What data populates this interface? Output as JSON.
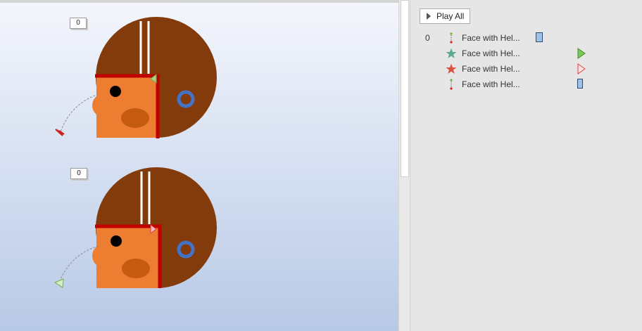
{
  "slide": {
    "tags": [
      "0",
      "0"
    ]
  },
  "pane": {
    "play_all_label": "Play All",
    "items": [
      {
        "number": "0",
        "label": "Face with Hel...",
        "icon": "motion-path-icon",
        "timeline": "timeline-bar-blue"
      },
      {
        "number": "",
        "label": "Face with Hel...",
        "icon": "entrance-star-icon",
        "timeline": "play-marker-green"
      },
      {
        "number": "",
        "label": "Face with Hel...",
        "icon": "exit-star-icon",
        "timeline": "play-marker-red"
      },
      {
        "number": "",
        "label": "Face with Hel...",
        "icon": "motion-path-icon",
        "timeline": "timeline-bar-blue"
      }
    ]
  },
  "colors": {
    "helmet": "#833b0b",
    "face": "#ed7d31",
    "cheek": "#c55a11",
    "stripe": "#c00000",
    "ear_ring": "#4472c4",
    "entrance": "#70ad47",
    "exit": "#e04040",
    "timeline_bar": "#9dc3e6"
  }
}
